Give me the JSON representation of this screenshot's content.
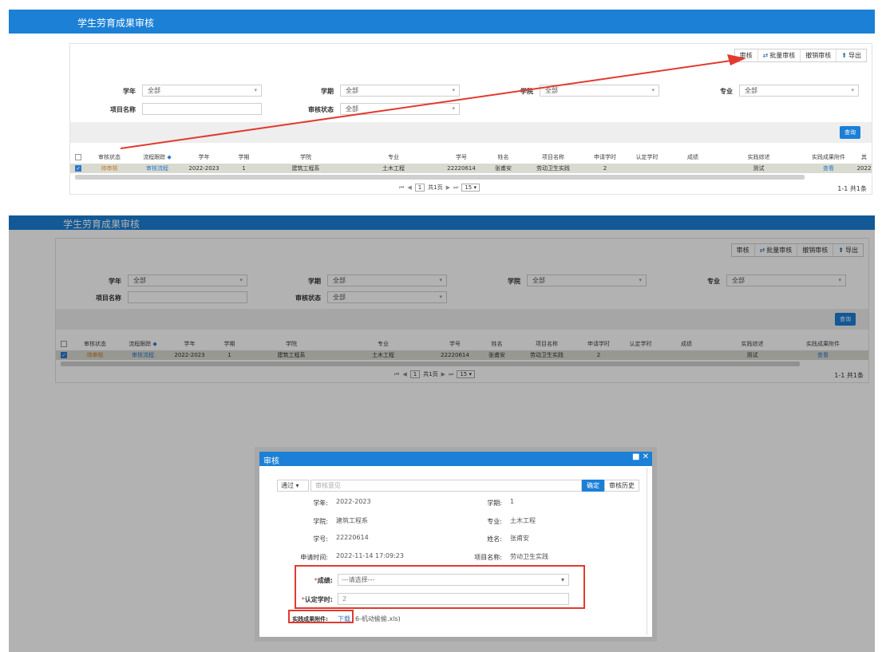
{
  "app_title": "学生劳育成果审核",
  "toolbar": {
    "audit": "审核",
    "batch_icon": "⇄",
    "batch_audit": "批量审核",
    "revoke_audit": "撤销审核",
    "export_icon": "⬆",
    "export": "导出"
  },
  "filters": {
    "school_year_label": "学年",
    "school_year_value": "全部",
    "semester_label": "学期",
    "semester_value": "全部",
    "college_label": "学院",
    "college_value": "全部",
    "major_label": "专业",
    "major_value": "全部",
    "project_name_label": "项目名称",
    "audit_status_label": "审核状态",
    "audit_status_value": "全部",
    "query_button": "查询"
  },
  "table": {
    "headers": {
      "audit_status": "审核状态",
      "flow_trace": "流程跟踪",
      "school_year": "学年",
      "semester": "学期",
      "college": "学院",
      "major": "专业",
      "student_no": "学号",
      "name": "姓名",
      "project_name": "项目名称",
      "applied_hours": "申请学时",
      "approved_hours": "认定学时",
      "score": "成绩",
      "description": "实践综述",
      "attachment": "实践成果附件",
      "extra": "其"
    },
    "row": {
      "audit_status": "待审核",
      "flow_trace": "审核流程",
      "school_year": "2022-2023",
      "semester": "1",
      "college": "建筑工程系",
      "major": "土木工程",
      "student_no": "22220614",
      "name": "张甫安",
      "project_name": "劳动卫生实践",
      "applied_hours": "2",
      "approved_hours": "",
      "score": "",
      "description": "测试",
      "attachment": "查看",
      "extra": "2022"
    }
  },
  "pagination": {
    "page": "1",
    "total_pages_text": "共1页",
    "page_size": "15",
    "summary": "1-1 共1条"
  },
  "modal": {
    "title": "审核",
    "controls": "■ ✕",
    "decision": "通过",
    "opinion_placeholder": "审核意见",
    "confirm": "确定",
    "history": "审核历史",
    "school_year_label": "学年:",
    "school_year": "2022-2023",
    "semester_label": "学期:",
    "semester": "1",
    "college_label": "学院:",
    "college": "建筑工程系",
    "major_label": "专业:",
    "major": "土木工程",
    "student_no_label": "学号:",
    "student_no": "22220614",
    "name_label": "姓名:",
    "name": "张甫安",
    "apply_time_label": "申请时间:",
    "apply_time": "2022-11-14 17:09:23",
    "project_label": "项目名称:",
    "project": "劳动卫生实践",
    "score_label": "成绩:",
    "score_placeholder": "---请选择---",
    "approved_hours_label": "认定学时:",
    "approved_hours": "2",
    "attachment_label": "实践成果附件:",
    "download": "下载",
    "file_suffix": "6-机动偷偷.xls)"
  },
  "colors": {
    "brand_blue": "#1b80d6",
    "highlight_red": "#e23a2f",
    "row_gray": "#d9dad0"
  }
}
